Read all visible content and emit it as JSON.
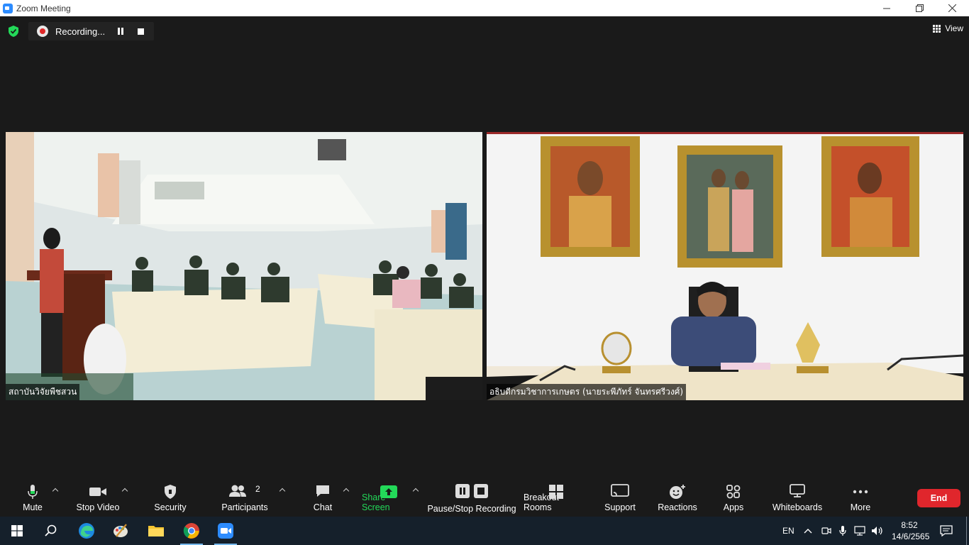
{
  "window": {
    "title": "Zoom Meeting"
  },
  "recording": {
    "status": "Recording..."
  },
  "view_label": "View",
  "videos": [
    {
      "name": "สถาบันวิจัยพืชสวน"
    },
    {
      "name": "อธิบดีกรมวิชาการเกษตร (นายระพีภัทร์ จันทรศรีวงศ์)"
    }
  ],
  "toolbar": {
    "mute": "Mute",
    "stop_video": "Stop Video",
    "security": "Security",
    "participants": "Participants",
    "participant_count": "2",
    "chat": "Chat",
    "share_screen": "Share Screen",
    "pause_stop_recording": "Pause/Stop Recording",
    "breakout_rooms": "Breakout Rooms",
    "support": "Support",
    "reactions": "Reactions",
    "apps": "Apps",
    "whiteboards": "Whiteboards",
    "more": "More",
    "end": "End"
  },
  "colors": {
    "share_green": "#23d959",
    "end_red": "#e0262c",
    "taskbar": "#15202b"
  },
  "taskbar": {
    "apps": [
      "windows-start",
      "search",
      "edge",
      "paint",
      "file-explorer",
      "chrome",
      "zoom"
    ],
    "language": "EN",
    "time": "8:52",
    "date": "14/6/2565"
  }
}
